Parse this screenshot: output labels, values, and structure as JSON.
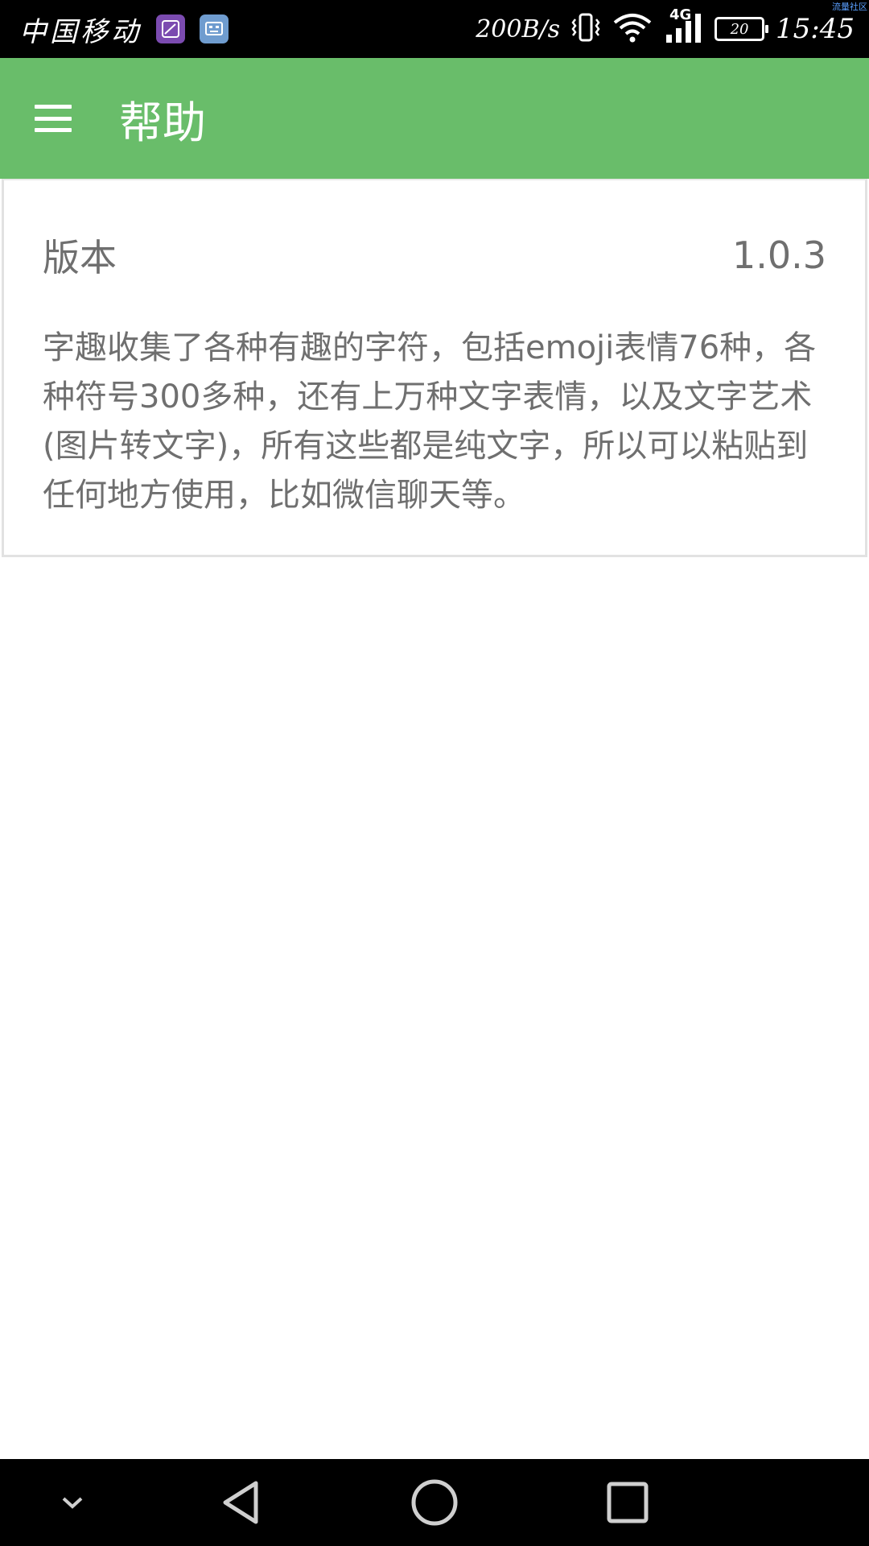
{
  "status_bar": {
    "carrier": "中国移动",
    "network_speed": "200B/s",
    "network_type": "4G",
    "battery_level": "20",
    "time": "15:45",
    "corner_label": "流量社区"
  },
  "app_bar": {
    "title": "帮助"
  },
  "card": {
    "version_label": "版本",
    "version_value": "1.0.3",
    "description": "字趣收集了各种有趣的字符，包括emoji表情76种，各种符号300多种，还有上万种文字表情，以及文字艺术(图片转文字)，所有这些都是纯文字，所以可以粘贴到任何地方使用，比如微信聊天等。"
  },
  "colors": {
    "app_bar": "#69bd6a",
    "status_bar": "#000000",
    "nav_bar": "#000000",
    "text_secondary": "#6f6f6f"
  },
  "icons": {
    "menu": "hamburger-menu-icon",
    "nav": [
      "chevron-down-icon",
      "back-triangle-icon",
      "home-circle-icon",
      "recents-square-icon"
    ]
  }
}
